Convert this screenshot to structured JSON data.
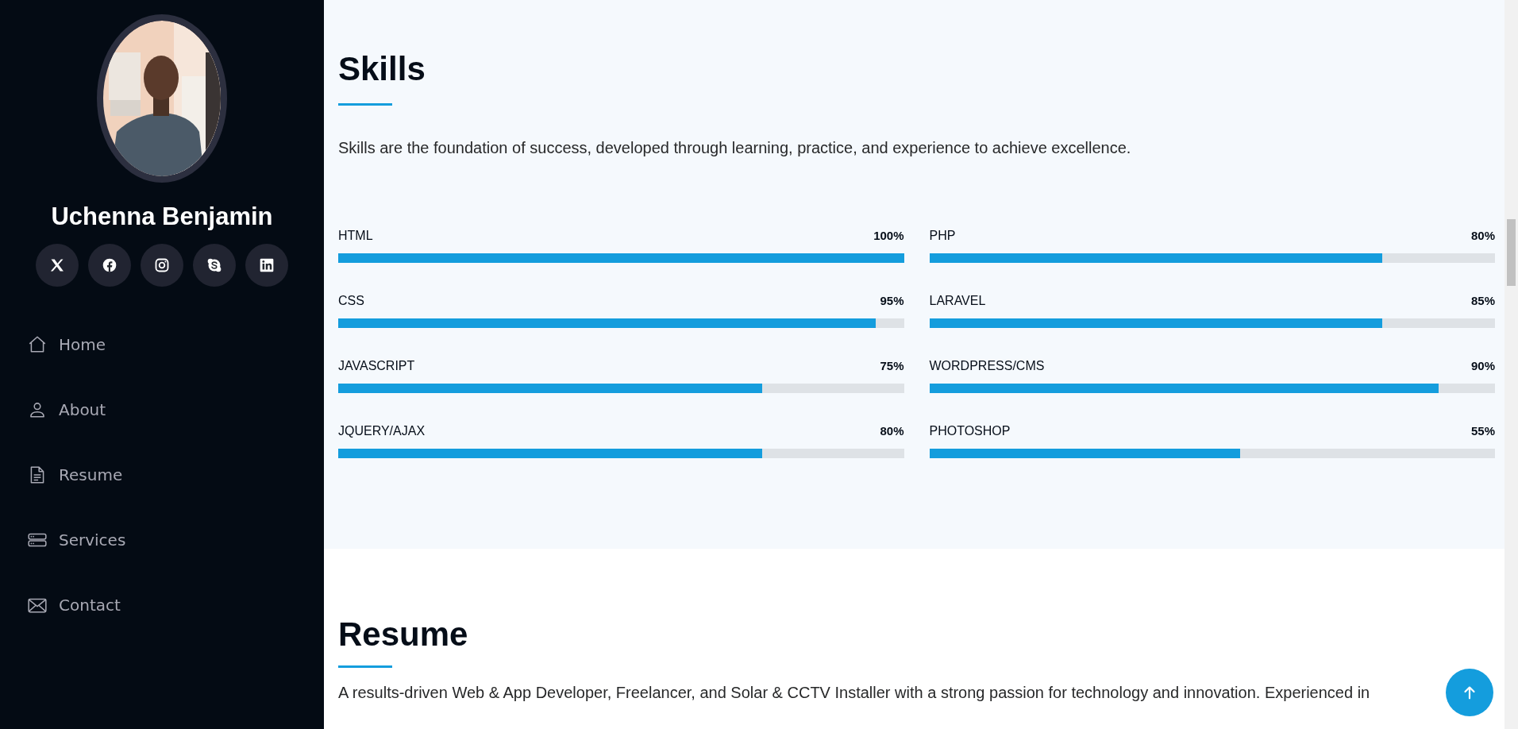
{
  "profile": {
    "name": "Uchenna Benjamin",
    "socials": [
      {
        "kind": "x"
      },
      {
        "kind": "facebook"
      },
      {
        "kind": "instagram"
      },
      {
        "kind": "skype"
      },
      {
        "kind": "linkedin"
      }
    ]
  },
  "nav": [
    {
      "label": "Home",
      "kind": "home"
    },
    {
      "label": "About",
      "kind": "person"
    },
    {
      "label": "Resume",
      "kind": "file"
    },
    {
      "label": "Services",
      "kind": "server"
    },
    {
      "label": "Contact",
      "kind": "envelope"
    }
  ],
  "skills": {
    "title": "Skills",
    "description": "Skills are the foundation of success, developed through learning, practice, and experience to achieve excellence.",
    "columns": [
      [
        {
          "name": "HTML",
          "reading": "100%",
          "level": 1.0
        },
        {
          "name": "CSS",
          "reading": "95%",
          "level": 0.95
        },
        {
          "name": "JAVASCRIPT",
          "reading": "75%",
          "level": 0.75
        },
        {
          "name": "JQUERY/AJAX",
          "reading": "80%",
          "level": 0.75
        }
      ],
      [
        {
          "name": "PHP",
          "reading": "80%",
          "level": 0.8
        },
        {
          "name": "LARAVEL",
          "reading": "85%",
          "level": 0.8
        },
        {
          "name": "WORDPRESS/CMS",
          "reading": "90%",
          "level": 0.9
        },
        {
          "name": "PHOTOSHOP",
          "reading": "55%",
          "level": 0.55
        }
      ]
    ]
  },
  "resume": {
    "title": "Resume",
    "text": "A results-driven Web & App Developer, Freelancer, and Solar & CCTV Installer with a strong passion for technology and innovation. Experienced in"
  }
}
